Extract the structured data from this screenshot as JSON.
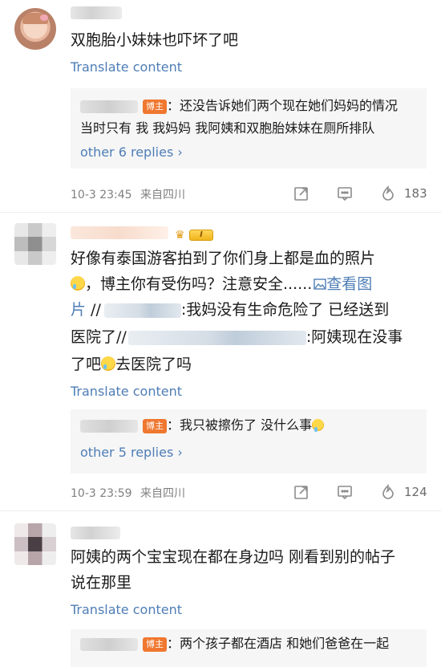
{
  "comments": [
    {
      "text": "双胞胎小妹妹也吓坏了吧",
      "translate_label": "Translate content",
      "reply": {
        "author_tag": "博主",
        "line1": "：还没告诉她们两个现在她们妈妈的情况",
        "line2": "当时只有 我 我妈妈 我阿姨和双胞胎妹妹在厕所排队"
      },
      "more_replies": "other 6 replies ›",
      "time": "10-3 23:45",
      "source": "来自四川",
      "likes": "183"
    },
    {
      "text_line1": "好像有泰国游客拍到了你们身上都是血的照片",
      "text_line2_a": "，博主你有受伤吗？注意安全......",
      "image_link_icon": "image-icon",
      "image_link_label_1": "查看图",
      "image_link_label_2": "片",
      "text_line3_sep": " //",
      "text_line3_b": ":我妈没有生命危险了 已经送到",
      "text_line4_a": "医院了//",
      "text_line4_b": ":阿姨现在没事",
      "text_line5_a": "了吧",
      "text_line5_b": "去医院了吗",
      "vip_level": "I",
      "translate_label": "Translate content",
      "reply": {
        "author_tag": "博主",
        "line1": "：我只被擦伤了 没什么事"
      },
      "more_replies": "other 5 replies ›",
      "time": "10-3 23:59",
      "source": "来自四川",
      "likes": "124"
    },
    {
      "text_line1": "阿姨的两个宝宝现在都在身边吗 刚看到别的帖子",
      "text_line2": "说在那里",
      "translate_label": "Translate content",
      "reply": {
        "author_tag": "博主",
        "line1": "：两个孩子都在酒店 和她们爸爸在一起"
      }
    }
  ],
  "icons": {
    "share": "share-icon",
    "comment": "comment-icon",
    "like": "thumbs-up-icon"
  },
  "colors": {
    "link": "#4e7db6",
    "author_tag": "#f0772f",
    "meta": "#808080"
  }
}
